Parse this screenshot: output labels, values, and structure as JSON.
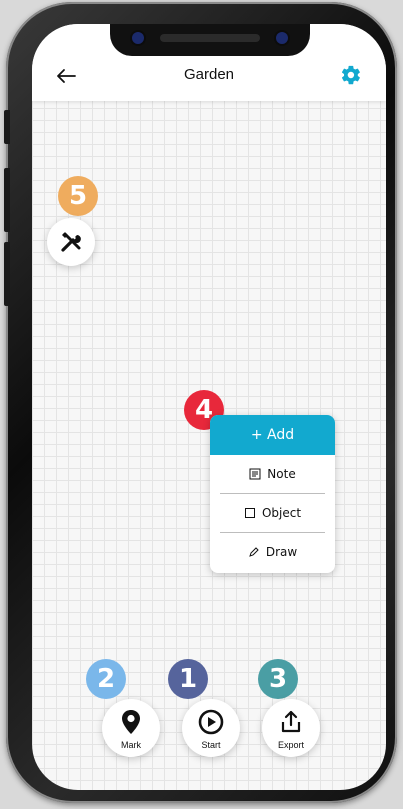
{
  "header": {
    "title": "Garden"
  },
  "icons": {
    "back": "arrow-left-icon",
    "settings": "gear-icon",
    "tools": "tools-icon"
  },
  "colors": {
    "accent": "#12a9cf",
    "badge_1": "#56649c",
    "badge_2": "#7ab7ea",
    "badge_3": "#4a9ea4",
    "badge_4": "#e8283b",
    "badge_5": "#efac5e"
  },
  "badges": {
    "b1": "1",
    "b2": "2",
    "b3": "3",
    "b4": "4",
    "b5": "5"
  },
  "add_menu": {
    "add_label": "+ Add",
    "items": [
      {
        "label": "Note",
        "icon": "note-icon"
      },
      {
        "label": "Object",
        "icon": "square-icon"
      },
      {
        "label": "Draw",
        "icon": "pen-icon"
      }
    ]
  },
  "toolbar": {
    "mark_label": "Mark",
    "start_label": "Start",
    "export_label": "Export"
  }
}
